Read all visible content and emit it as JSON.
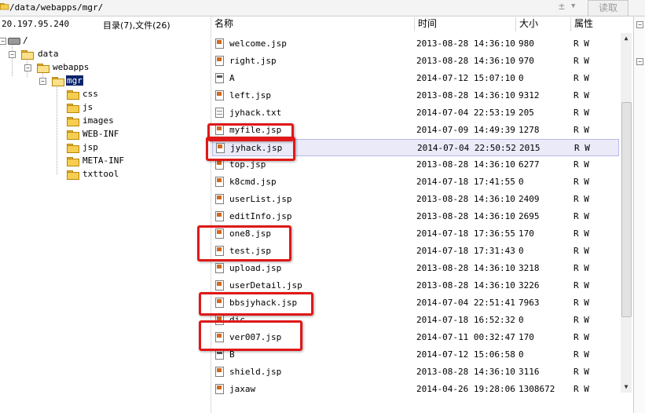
{
  "pathbar": {
    "path": "/data/webapps/mgr/",
    "read_button": "读取"
  },
  "left_header": {
    "ip": "20.197.95.240",
    "count": "目录(7),文件(26)"
  },
  "tree": {
    "root": "/",
    "data": "data",
    "webapps": "webapps",
    "mgr": "mgr",
    "children": [
      "css",
      "js",
      "images",
      "WEB-INF",
      "jsp",
      "META-INF",
      "txttool"
    ]
  },
  "columns": {
    "name": "名称",
    "time": "时间",
    "size": "大小",
    "attr": "属性"
  },
  "files": [
    {
      "name": "welcome.jsp",
      "time": "2013-08-28 14:36:10",
      "size": "980",
      "attr": "R W",
      "icon": "jsp"
    },
    {
      "name": "right.jsp",
      "time": "2013-08-28 14:36:10",
      "size": "970",
      "attr": "R W",
      "icon": "jsp"
    },
    {
      "name": "A",
      "time": "2014-07-12 15:07:10",
      "size": "0",
      "attr": "R W",
      "icon": "bin"
    },
    {
      "name": "left.jsp",
      "time": "2013-08-28 14:36:10",
      "size": "9312",
      "attr": "R W",
      "icon": "jsp"
    },
    {
      "name": "jyhack.txt",
      "time": "2014-07-04 22:53:19",
      "size": "205",
      "attr": "R W",
      "icon": "txt"
    },
    {
      "name": "myfile.jsp",
      "time": "2014-07-09 14:49:39",
      "size": "1278",
      "attr": "R W",
      "icon": "jsp"
    },
    {
      "name": "jyhack.jsp",
      "time": "2014-07-04 22:50:52",
      "size": "2015",
      "attr": "R W",
      "icon": "jsp"
    },
    {
      "name": "top.jsp",
      "time": "2013-08-28 14:36:10",
      "size": "6277",
      "attr": "R W",
      "icon": "jsp"
    },
    {
      "name": "k8cmd.jsp",
      "time": "2014-07-18 17:41:55",
      "size": "0",
      "attr": "R W",
      "icon": "jsp"
    },
    {
      "name": "userList.jsp",
      "time": "2013-08-28 14:36:10",
      "size": "2409",
      "attr": "R W",
      "icon": "jsp"
    },
    {
      "name": "editInfo.jsp",
      "time": "2013-08-28 14:36:10",
      "size": "2695",
      "attr": "R W",
      "icon": "jsp"
    },
    {
      "name": "one8.jsp",
      "time": "2014-07-18 17:36:55",
      "size": "170",
      "attr": "R W",
      "icon": "jsp"
    },
    {
      "name": "test.jsp",
      "time": "2014-07-18 17:31:43",
      "size": "0",
      "attr": "R W",
      "icon": "jsp"
    },
    {
      "name": "upload.jsp",
      "time": "2013-08-28 14:36:10",
      "size": "3218",
      "attr": "R W",
      "icon": "jsp"
    },
    {
      "name": "userDetail.jsp",
      "time": "2013-08-28 14:36:10",
      "size": "3226",
      "attr": "R W",
      "icon": "jsp"
    },
    {
      "name": "bbsjyhack.jsp",
      "time": "2014-07-04 22:51:41",
      "size": "7963",
      "attr": "R W",
      "icon": "jsp"
    },
    {
      "name": "dic",
      "time": "2014-07-18 16:52:32",
      "size": "0",
      "attr": "R W",
      "icon": "jsp"
    },
    {
      "name": "ver007.jsp",
      "time": "2014-07-11 00:32:47",
      "size": "170",
      "attr": "R W",
      "icon": "jsp"
    },
    {
      "name": "B",
      "time": "2014-07-12 15:06:58",
      "size": "0",
      "attr": "R W",
      "icon": "bin"
    },
    {
      "name": "shield.jsp",
      "time": "2013-08-28 14:36:10",
      "size": "3116",
      "attr": "R W",
      "icon": "jsp"
    },
    {
      "name": "jaxaw",
      "time": "2014-04-26 19:28:06",
      "size": "1308672",
      "attr": "R W",
      "icon": "jsp"
    }
  ],
  "selected_file": "jyhack.jsp",
  "highlight_color": "#e01818"
}
